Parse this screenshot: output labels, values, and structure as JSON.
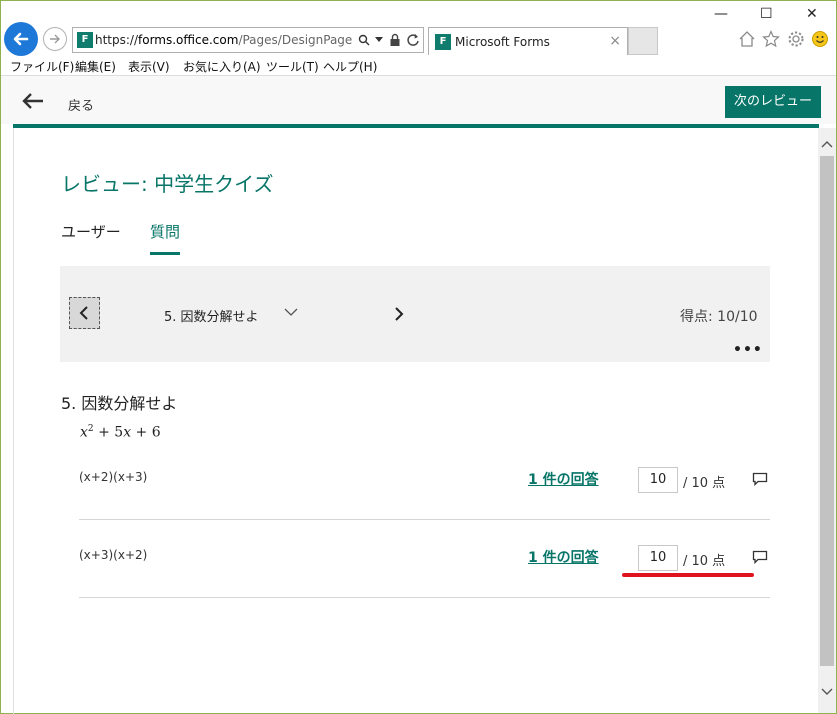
{
  "browser": {
    "url_prefix": "https://",
    "url_domain": "forms.office.com",
    "url_rest": "/Pages/DesignPage.aspx",
    "tab_title": "Microsoft Forms",
    "favicon_text": "F",
    "win_minimize": "—",
    "win_maximize": "☐",
    "win_close": "✕",
    "tab_close": "×",
    "menu": [
      "ファイル(F)",
      "編集(E)",
      "表示(V)",
      "お気に入り(A)",
      "ツール(T)",
      "ヘルプ(H)"
    ]
  },
  "header": {
    "back_label": "戻る",
    "next_review_label": "次のレビュー"
  },
  "review": {
    "title": "レビュー: 中学生クイズ",
    "tabs": [
      "ユーザー",
      "質問"
    ],
    "active_tab": "質問"
  },
  "navigator": {
    "question_label": "5. 因数分解せよ",
    "score_label": "得点: 10/10",
    "more_label": "•••"
  },
  "question": {
    "heading": "5. 因数分解せよ",
    "formula": {
      "x": "x",
      "exp": "2",
      "rest": " + 5",
      "x2": "x",
      "tail": " + 6"
    },
    "answers": [
      {
        "text": "(x+2)(x+3)",
        "link": "1 件の回答",
        "points": "10",
        "total": "/ 10 点"
      },
      {
        "text": "(x+3)(x+2)",
        "link": "1 件の回答",
        "points": "10",
        "total": "/ 10 点"
      }
    ]
  },
  "colors": {
    "accent": "#077568",
    "highlight_mark": "#e0141f"
  }
}
